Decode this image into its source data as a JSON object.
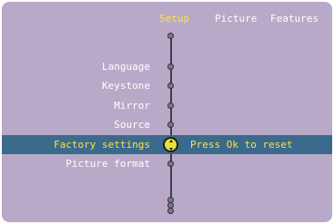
{
  "tabs": [
    {
      "label": "Setup",
      "active": true
    },
    {
      "label": "Picture",
      "active": false
    },
    {
      "label": "Features",
      "active": false
    }
  ],
  "menu": {
    "items": [
      {
        "label": "Language"
      },
      {
        "label": "Keystone"
      },
      {
        "label": "Mirror"
      },
      {
        "label": "Source"
      },
      {
        "label": "Factory settings",
        "selected": true
      },
      {
        "label": "Picture format"
      }
    ],
    "hint": "Press Ok to reset"
  },
  "colors": {
    "background": "#b8a9c9",
    "highlight": "#3a6a8c",
    "accent": "#ffe14a",
    "text": "#ffffff"
  },
  "icons": {
    "selector": "ok-selector-icon"
  }
}
